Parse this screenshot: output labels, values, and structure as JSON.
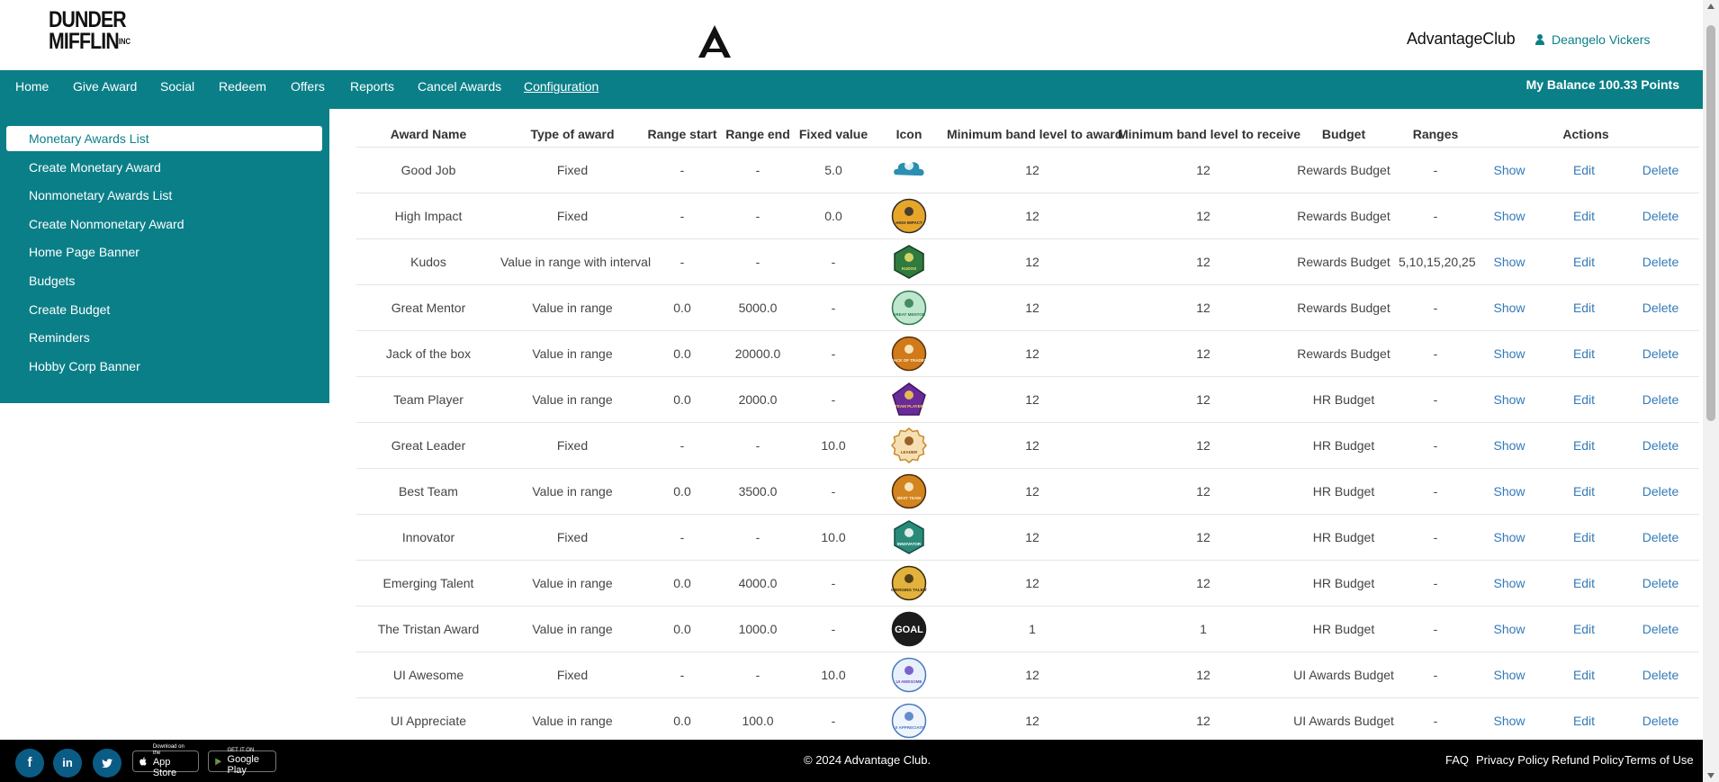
{
  "header": {
    "logo_line1": "DUNDER",
    "logo_line2": "MIFFLIN",
    "logo_suffix": "INC",
    "brand": "AdvantageClub",
    "user_name": "Deangelo Vickers"
  },
  "nav": {
    "items": [
      "Home",
      "Give Award",
      "Social",
      "Redeem",
      "Offers",
      "Reports",
      "Cancel Awards",
      "Configuration"
    ],
    "active": "Configuration",
    "balance": "My Balance 100.33 Points"
  },
  "sidebar": {
    "items": [
      "Monetary Awards List",
      "Create Monetary Award",
      "Nonmonetary Awards List",
      "Create Nonmonetary Award",
      "Home Page Banner",
      "Budgets",
      "Create Budget",
      "Reminders",
      "Hobby Corp Banner"
    ],
    "active": "Monetary Awards List"
  },
  "table": {
    "headers": [
      "Award Name",
      "Type of award",
      "Range start",
      "Range end",
      "Fixed value",
      "Icon",
      "Minimum band level to award",
      "Minimum band level to receive",
      "Budget",
      "Ranges",
      "Actions"
    ],
    "action_labels": {
      "show": "Show",
      "edit": "Edit",
      "delete": "Delete"
    },
    "rows": [
      {
        "name": "Good Job",
        "type": "Fixed",
        "range_start": "-",
        "range_end": "-",
        "fixed": "5.0",
        "icon": "good-job-badge",
        "icon_text": "GOOD JOB",
        "min_award": "12",
        "min_receive": "12",
        "budget": "Rewards Budget",
        "ranges": "-"
      },
      {
        "name": "High Impact",
        "type": "Fixed",
        "range_start": "-",
        "range_end": "-",
        "fixed": "0.0",
        "icon": "high-impact-badge",
        "icon_text": "HIGH IMPACT",
        "min_award": "12",
        "min_receive": "12",
        "budget": "Rewards Budget",
        "ranges": "-"
      },
      {
        "name": "Kudos",
        "type": "Value in range with interval",
        "range_start": "-",
        "range_end": "-",
        "fixed": "-",
        "icon": "kudos-badge",
        "icon_text": "KUDOS",
        "min_award": "12",
        "min_receive": "12",
        "budget": "Rewards Budget",
        "ranges": "5,10,15,20,25"
      },
      {
        "name": "Great Mentor",
        "type": "Value in range",
        "range_start": "0.0",
        "range_end": "5000.0",
        "fixed": "-",
        "icon": "great-mentor-badge",
        "icon_text": "GREAT MENTOR",
        "min_award": "12",
        "min_receive": "12",
        "budget": "Rewards Budget",
        "ranges": "-"
      },
      {
        "name": "Jack of the box",
        "type": "Value in range",
        "range_start": "0.0",
        "range_end": "20000.0",
        "fixed": "-",
        "icon": "jack-of-all-trades-badge",
        "icon_text": "JACK OF TRADES",
        "min_award": "12",
        "min_receive": "12",
        "budget": "Rewards Budget",
        "ranges": "-"
      },
      {
        "name": "Team Player",
        "type": "Value in range",
        "range_start": "0.0",
        "range_end": "2000.0",
        "fixed": "-",
        "icon": "team-player-badge",
        "icon_text": "TEAM PLAYER",
        "min_award": "12",
        "min_receive": "12",
        "budget": "HR Budget",
        "ranges": "-"
      },
      {
        "name": "Great Leader",
        "type": "Fixed",
        "range_start": "-",
        "range_end": "-",
        "fixed": "10.0",
        "icon": "great-leader-badge",
        "icon_text": "LEADER",
        "min_award": "12",
        "min_receive": "12",
        "budget": "HR Budget",
        "ranges": "-"
      },
      {
        "name": "Best Team",
        "type": "Value in range",
        "range_start": "0.0",
        "range_end": "3500.0",
        "fixed": "-",
        "icon": "best-team-badge",
        "icon_text": "BEST TEAM",
        "min_award": "12",
        "min_receive": "12",
        "budget": "HR Budget",
        "ranges": "-"
      },
      {
        "name": "Innovator",
        "type": "Fixed",
        "range_start": "-",
        "range_end": "-",
        "fixed": "10.0",
        "icon": "innovator-badge",
        "icon_text": "INNOVATOR",
        "min_award": "12",
        "min_receive": "12",
        "budget": "HR Budget",
        "ranges": "-"
      },
      {
        "name": "Emerging Talent",
        "type": "Value in range",
        "range_start": "0.0",
        "range_end": "4000.0",
        "fixed": "-",
        "icon": "emerging-talent-badge",
        "icon_text": "EMERGING TALENT",
        "min_award": "12",
        "min_receive": "12",
        "budget": "HR Budget",
        "ranges": "-"
      },
      {
        "name": "The Tristan Award",
        "type": "Value in range",
        "range_start": "0.0",
        "range_end": "1000.0",
        "fixed": "-",
        "icon": "goal-badge",
        "icon_text": "GOAL",
        "min_award": "1",
        "min_receive": "1",
        "budget": "HR Budget",
        "ranges": "-"
      },
      {
        "name": "UI Awesome",
        "type": "Fixed",
        "range_start": "-",
        "range_end": "-",
        "fixed": "10.0",
        "icon": "ui-awesome-badge",
        "icon_text": "UI AWESOME",
        "min_award": "12",
        "min_receive": "12",
        "budget": "UI Awards Budget",
        "ranges": "-"
      },
      {
        "name": "UI Appreciate",
        "type": "Value in range",
        "range_start": "0.0",
        "range_end": "100.0",
        "fixed": "-",
        "icon": "ui-appreciate-badge",
        "icon_text": "UI APPRECIATE",
        "min_award": "12",
        "min_receive": "12",
        "budget": "UI Awards Budget",
        "ranges": "-"
      }
    ]
  },
  "footer": {
    "social": [
      {
        "icon": "facebook-icon",
        "glyph": "f"
      },
      {
        "icon": "linkedin-icon",
        "glyph": "in"
      },
      {
        "icon": "twitter-icon",
        "glyph": "t"
      }
    ],
    "app_store": {
      "small": "Download on the",
      "large": "App Store"
    },
    "google_play": {
      "small": "GET IT ON",
      "large": "Google Play"
    },
    "copyright": "© 2024 Advantage Club.",
    "links": [
      "FAQ",
      "Privacy Policy",
      "Refund Policy",
      "Terms of Use"
    ]
  },
  "colors": {
    "primary": "#0b7f88",
    "link": "#337ab7",
    "footer_bg": "#000000"
  }
}
